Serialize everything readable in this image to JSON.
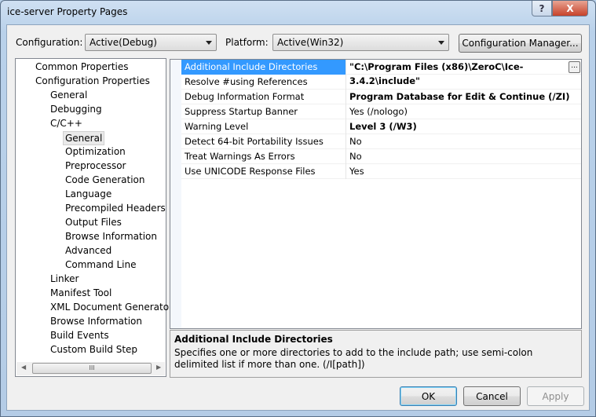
{
  "window": {
    "title": "ice-server Property Pages",
    "help": "?",
    "close": "X"
  },
  "toolbar": {
    "configuration_label": "Configuration:",
    "configuration_value": "Active(Debug)",
    "platform_label": "Platform:",
    "platform_value": "Active(Win32)",
    "config_manager": "Configuration Manager..."
  },
  "tree": {
    "items": [
      {
        "label": "Common Properties",
        "level": 0
      },
      {
        "label": "Configuration Properties",
        "level": 0
      },
      {
        "label": "General",
        "level": 1
      },
      {
        "label": "Debugging",
        "level": 1
      },
      {
        "label": "C/C++",
        "level": 1
      },
      {
        "label": "General",
        "level": 2,
        "selected": true
      },
      {
        "label": "Optimization",
        "level": 2
      },
      {
        "label": "Preprocessor",
        "level": 2
      },
      {
        "label": "Code Generation",
        "level": 2
      },
      {
        "label": "Language",
        "level": 2
      },
      {
        "label": "Precompiled Headers",
        "level": 2
      },
      {
        "label": "Output Files",
        "level": 2
      },
      {
        "label": "Browse Information",
        "level": 2
      },
      {
        "label": "Advanced",
        "level": 2
      },
      {
        "label": "Command Line",
        "level": 2
      },
      {
        "label": "Linker",
        "level": 1
      },
      {
        "label": "Manifest Tool",
        "level": 1
      },
      {
        "label": "XML Document Generator",
        "level": 1
      },
      {
        "label": "Browse Information",
        "level": 1
      },
      {
        "label": "Build Events",
        "level": 1
      },
      {
        "label": "Custom Build Step",
        "level": 1
      }
    ],
    "scroll_grip": "III"
  },
  "grid": {
    "rows": [
      {
        "name": "Additional Include Directories",
        "value": "\"C:\\Program Files (x86)\\ZeroC\\Ice-3.4.2\\include\"",
        "bold": true,
        "selected": true
      },
      {
        "name": "Resolve #using References",
        "value": ""
      },
      {
        "name": "Debug Information Format",
        "value": "Program Database for Edit & Continue (/ZI)",
        "bold": true
      },
      {
        "name": "Suppress Startup Banner",
        "value": "Yes (/nologo)"
      },
      {
        "name": "Warning Level",
        "value": "Level 3 (/W3)",
        "bold": true
      },
      {
        "name": "Detect 64-bit Portability Issues",
        "value": "No"
      },
      {
        "name": "Treat Warnings As Errors",
        "value": "No"
      },
      {
        "name": "Use UNICODE Response Files",
        "value": "Yes"
      }
    ],
    "ellipsis": "..."
  },
  "description": {
    "title": "Additional Include Directories",
    "text": "Specifies one or more directories to add to the include path; use semi-colon delimited list if more than one.     (/I[path])"
  },
  "buttons": {
    "ok": "OK",
    "cancel": "Cancel",
    "apply": "Apply"
  }
}
